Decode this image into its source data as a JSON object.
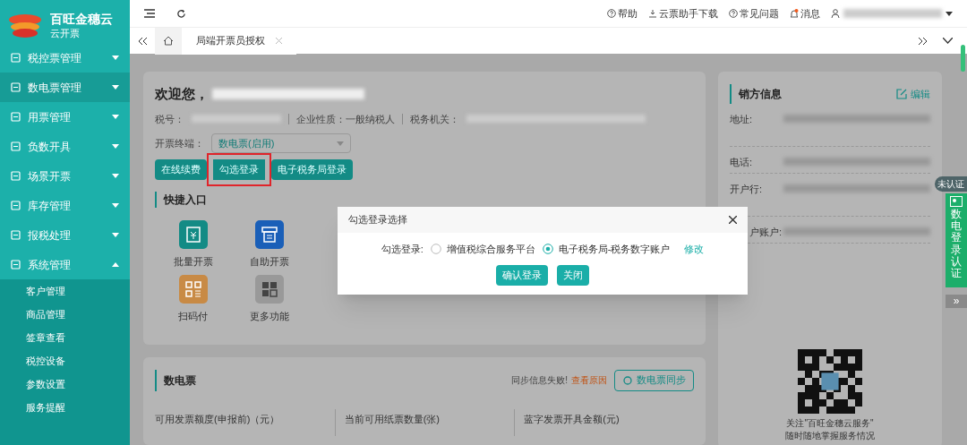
{
  "brand": {
    "name": "百旺金穗云",
    "subtitle": "云开票"
  },
  "sidebar": {
    "items": [
      {
        "label": "税控票管理",
        "expanded": false,
        "selected": false
      },
      {
        "label": "数电票管理",
        "expanded": false,
        "selected": true
      },
      {
        "label": "用票管理",
        "expanded": false,
        "selected": false
      },
      {
        "label": "负数开具",
        "expanded": false,
        "selected": false
      },
      {
        "label": "场景开票",
        "expanded": false,
        "selected": false
      },
      {
        "label": "库存管理",
        "expanded": false,
        "selected": false
      },
      {
        "label": "报税处理",
        "expanded": false,
        "selected": false
      },
      {
        "label": "系统管理",
        "expanded": true,
        "selected": false,
        "children": [
          {
            "label": "客户管理"
          },
          {
            "label": "商品管理"
          },
          {
            "label": "签章查看"
          },
          {
            "label": "税控设备"
          },
          {
            "label": "参数设置"
          },
          {
            "label": "服务提醒"
          }
        ]
      }
    ]
  },
  "toolbar": {
    "links": [
      {
        "kind": "help",
        "label": "帮助"
      },
      {
        "kind": "download",
        "label": "云票助手下载"
      },
      {
        "kind": "help",
        "label": "常见问题"
      },
      {
        "kind": "bell",
        "label": "消息",
        "unread": true
      }
    ]
  },
  "tabs": [
    {
      "label": "局端开票员授权",
      "selected": true
    }
  ],
  "welcome": {
    "greeting": "欢迎您，",
    "tax_id_label": "税号：",
    "nature_label": "企业性质：",
    "nature": "一般纳税人",
    "authority_label": "税务机关：",
    "terminal_label": "开票终端：",
    "terminal": "数电票(启用)",
    "buttons": [
      {
        "label": "在线续费",
        "highlighted": false
      },
      {
        "label": "勾选登录",
        "highlighted": true
      },
      {
        "label": "电子税务局登录",
        "highlighted": false
      }
    ]
  },
  "quick_entry": {
    "title": "快捷入口",
    "items": [
      {
        "kind": "batch",
        "label": "批量开票"
      },
      {
        "kind": "self",
        "label": "自助开票"
      },
      {
        "kind": "scan",
        "label": "扫码付"
      },
      {
        "kind": "more",
        "label": "更多功能"
      }
    ]
  },
  "digital_invoice": {
    "title": "数电票",
    "sync_status": "同步信息失败!",
    "sync_link": "查看原因",
    "sync_button": "数电票同步",
    "stats": [
      {
        "label": "可用发票额度(申报前)（元）"
      },
      {
        "label": "当前可用纸票数量(张)"
      },
      {
        "label": "蓝字发票开具金额(元)"
      }
    ]
  },
  "seller_info": {
    "title": "销方信息",
    "edit": "编辑",
    "fields": [
      {
        "label": "地址:"
      },
      {
        "label": "电话:"
      },
      {
        "label": "开户行:"
      },
      {
        "label": "户账户:"
      }
    ],
    "qr_caption": "关注\"百旺金穗云服务\"\n随时随地掌握服务情况"
  },
  "side_widget": {
    "badge": "未认证",
    "label": "数电登录认证",
    "collapse": "»"
  },
  "dialog": {
    "title": "勾选登录选择",
    "field_label": "勾选登录:",
    "options": [
      {
        "label": "增值税综合服务平台",
        "selected": false
      },
      {
        "label": "电子税务局-税务数字账户",
        "selected": true
      }
    ],
    "modify": "修改",
    "buttons": [
      {
        "label": "确认登录"
      },
      {
        "label": "关闭"
      }
    ]
  }
}
